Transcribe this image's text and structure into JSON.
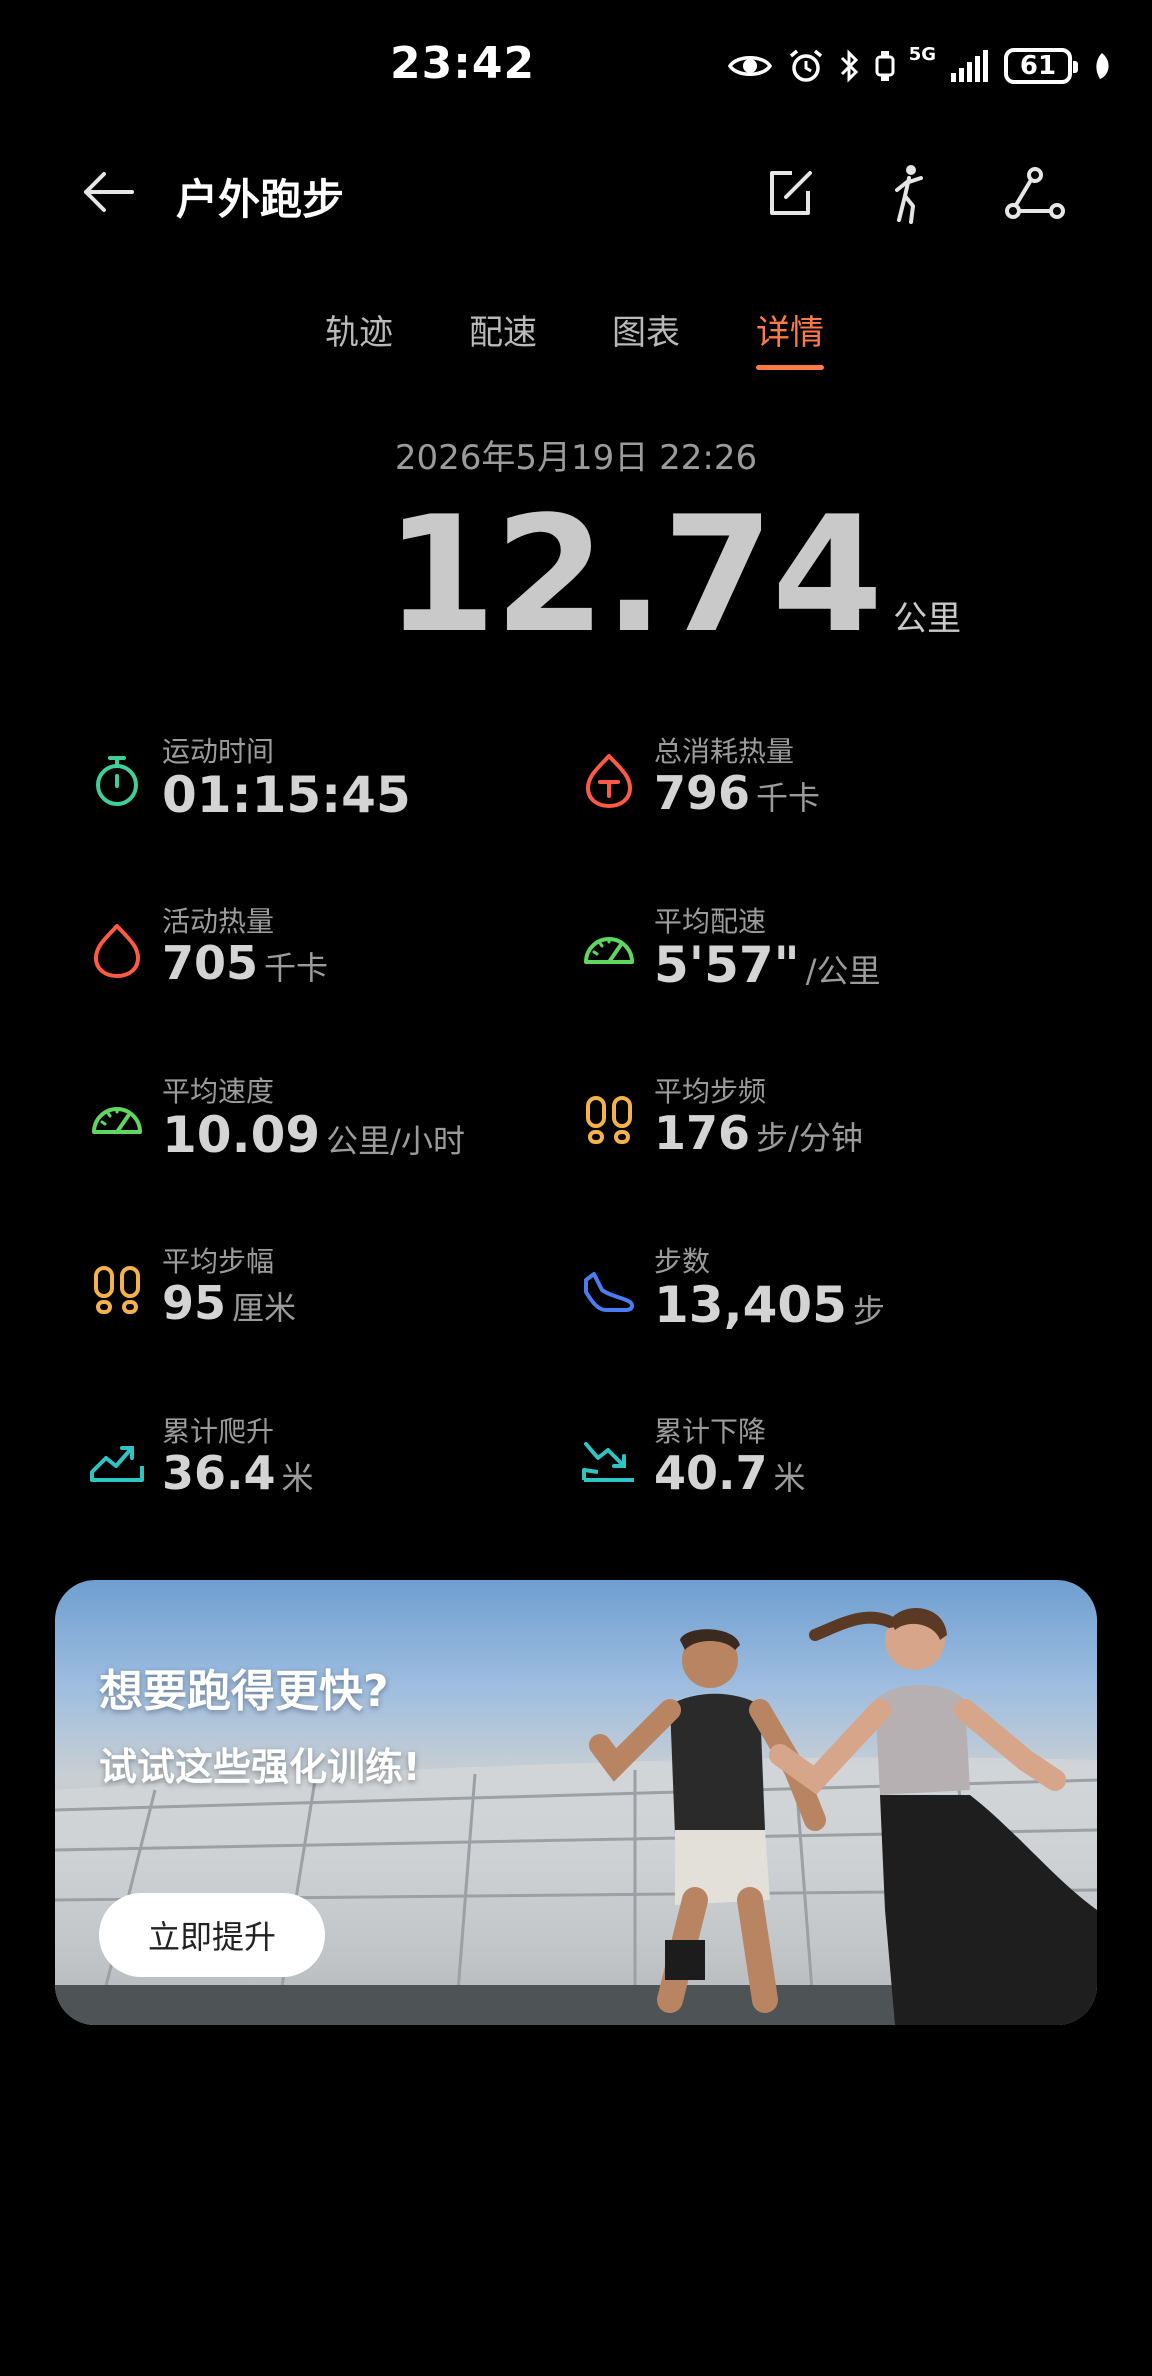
{
  "status_bar": {
    "time": "23:42",
    "network": "5G",
    "battery": "61"
  },
  "header": {
    "title": "户外跑步"
  },
  "tabs": [
    {
      "label": "轨迹",
      "active": false
    },
    {
      "label": "配速",
      "active": false
    },
    {
      "label": "图表",
      "active": false
    },
    {
      "label": "详情",
      "active": true
    }
  ],
  "summary": {
    "datetime": "2026年5月19日 22:26",
    "distance": "12.74",
    "distance_unit": "公里"
  },
  "stats": [
    {
      "label": "运动时间",
      "value": "01:15:45",
      "unit": "",
      "icon": "stopwatch-icon",
      "color": "#3ecf9b"
    },
    {
      "label": "总消耗热量",
      "value": "796",
      "unit": "千卡",
      "icon": "calorie-total-icon",
      "color": "#ff5a43"
    },
    {
      "label": "活动热量",
      "value": "705",
      "unit": "千卡",
      "icon": "flame-icon",
      "color": "#ff5a43"
    },
    {
      "label": "平均配速",
      "value": "5'57\"",
      "unit": "/公里",
      "icon": "speedometer-icon",
      "color": "#5fd65f"
    },
    {
      "label": "平均速度",
      "value": "10.09",
      "unit": "公里/小时",
      "icon": "speed-gauge-icon",
      "color": "#5fd65f"
    },
    {
      "label": "平均步频",
      "value": "176",
      "unit": "步/分钟",
      "icon": "footprints-icon",
      "color": "#f3b24a"
    },
    {
      "label": "平均步幅",
      "value": "95",
      "unit": "厘米",
      "icon": "footprints-icon",
      "color": "#f3b24a"
    },
    {
      "label": "步数",
      "value": "13,405",
      "unit": "步",
      "icon": "shoe-icon",
      "color": "#4a7cf3"
    },
    {
      "label": "累计爬升",
      "value": "36.4",
      "unit": "米",
      "icon": "elevation-gain-icon",
      "color": "#2ec4c4"
    },
    {
      "label": "累计下降",
      "value": "40.7",
      "unit": "米",
      "icon": "elevation-loss-icon",
      "color": "#2ec4c4"
    }
  ],
  "promo": {
    "title": "想要跑得更快?",
    "subtitle": "试试这些强化训练!",
    "button_label": "立即提升"
  },
  "colors": {
    "accent": "#ff7a45",
    "background": "#000000"
  }
}
